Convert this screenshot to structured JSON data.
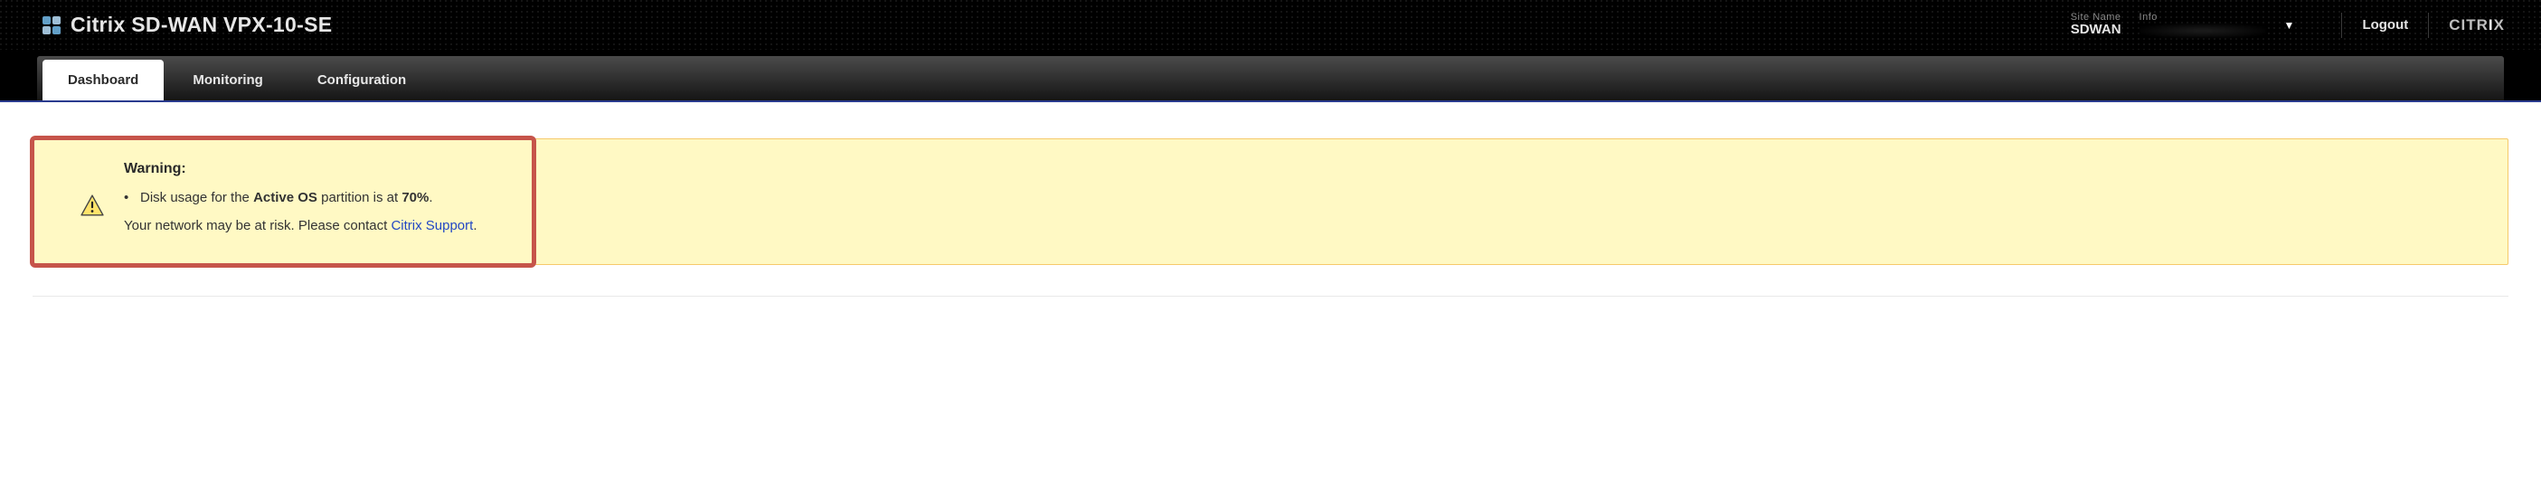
{
  "header": {
    "product_title": "Citrix SD-WAN VPX-10-SE",
    "site_name_label": "Site Name",
    "site_name_value": "SDWAN",
    "info_label": "Info",
    "logout_label": "Logout",
    "brand_text": "CITRIX"
  },
  "tabs": {
    "dashboard": "Dashboard",
    "monitoring": "Monitoring",
    "configuration": "Configuration",
    "active": "dashboard"
  },
  "warning": {
    "heading": "Warning:",
    "item_prefix": "Disk usage for the ",
    "item_bold1": "Active OS",
    "item_mid": " partition is at ",
    "item_bold2": "70%",
    "item_suffix": ".",
    "risk_prefix": "Your network may be at risk. Please contact ",
    "risk_link_text": "Citrix Support",
    "risk_suffix": "."
  }
}
